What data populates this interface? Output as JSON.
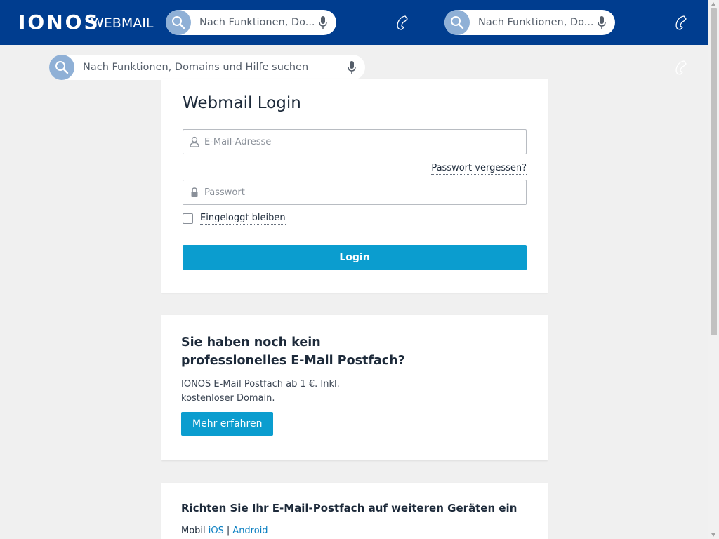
{
  "header": {
    "logo": "IONOS",
    "product": "WEBMAIL",
    "search_placeholder_short": "Nach Funktionen, Do...",
    "search_placeholder_full": "Nach Funktionen, Domains und Hilfe suchen"
  },
  "login": {
    "title": "Webmail Login",
    "email_placeholder": "E-Mail-Adresse",
    "forgot_password": "Passwort vergessen?",
    "password_placeholder": "Passwort",
    "remember_me": "Eingeloggt bleiben",
    "submit": "Login"
  },
  "promo": {
    "title": "Sie haben noch kein professionelles E-Mail Postfach?",
    "text": "IONOS E-Mail Postfach ab 1 €. Inkl. kostenloser Domain.",
    "button": "Mehr erfahren"
  },
  "devices": {
    "title": "Richten Sie Ihr E-Mail-Postfach auf weiteren Geräten ein",
    "mobile_label": "Mobil",
    "links": [
      "iOS",
      "Android"
    ]
  },
  "colors": {
    "header_bg": "#003d8f",
    "accent": "#0b9dcf",
    "link": "#0b7fc1",
    "page_bg": "#f0f0f0"
  },
  "icons": [
    "search-icon",
    "microphone-icon",
    "phone-icon",
    "user-icon",
    "lock-icon"
  ]
}
